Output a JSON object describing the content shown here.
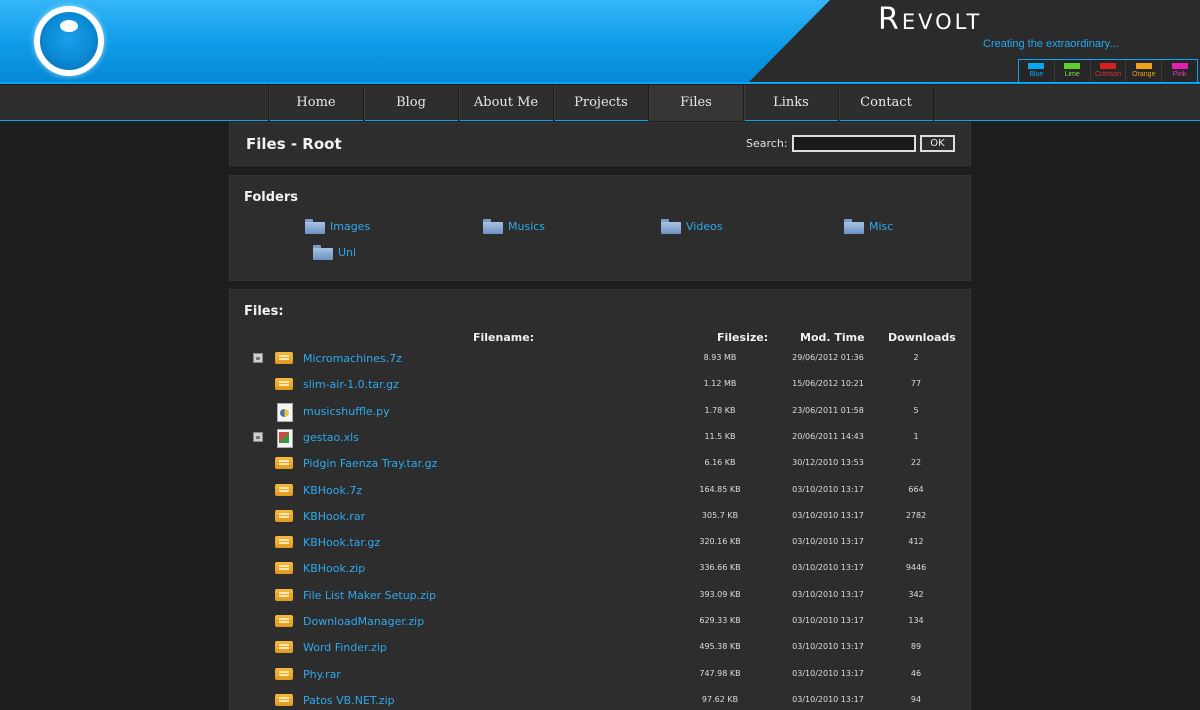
{
  "brand": {
    "title": "Revolt",
    "tagline": "Creating the extraordinary..."
  },
  "themes": [
    {
      "label": "Blue",
      "color": "#0aa5f5",
      "text": "#0aa5f5"
    },
    {
      "label": "Lime",
      "color": "#5ad12a",
      "text": "#7ce04a"
    },
    {
      "label": "Crimson",
      "color": "#d42020",
      "text": "#e03030"
    },
    {
      "label": "Orange",
      "color": "#f0a020",
      "text": "#f0a020"
    },
    {
      "label": "Pink",
      "color": "#e020b0",
      "text": "#e040c0"
    }
  ],
  "nav": [
    "Home",
    "Blog",
    "About Me",
    "Projects",
    "Files",
    "Links",
    "Contact"
  ],
  "nav_active": "Files",
  "page_title": "Files - Root",
  "search": {
    "label": "Search:",
    "value": "",
    "button": "OK"
  },
  "folders_title": "Folders",
  "folders": [
    "Images",
    "Musics",
    "Videos",
    "Misc",
    "Uni"
  ],
  "files_title": "Files:",
  "columns": {
    "filename": "Filename:",
    "filesize": "Filesize:",
    "modtime": "Mod. Time",
    "downloads": "Downloads"
  },
  "files": [
    {
      "name": "Micromachines.7z",
      "size": "8.93 MB",
      "time": "29/06/2012 01:36",
      "downloads": "2",
      "icon": "archive",
      "locked": true
    },
    {
      "name": "slim-air-1.0.tar.gz",
      "size": "1.12 MB",
      "time": "15/06/2012 10:21",
      "downloads": "77",
      "icon": "archive",
      "locked": false
    },
    {
      "name": "musicshuffle.py",
      "size": "1.78 KB",
      "time": "23/06/2011 01:58",
      "downloads": "5",
      "icon": "py",
      "locked": false
    },
    {
      "name": "gestao.xls",
      "size": "11.5 KB",
      "time": "20/06/2011 14:43",
      "downloads": "1",
      "icon": "xls",
      "locked": true
    },
    {
      "name": "Pidgin Faenza Tray.tar.gz",
      "size": "6.16 KB",
      "time": "30/12/2010 13:53",
      "downloads": "22",
      "icon": "archive",
      "locked": false
    },
    {
      "name": "KBHook.7z",
      "size": "164.85 KB",
      "time": "03/10/2010 13:17",
      "downloads": "664",
      "icon": "archive",
      "locked": false
    },
    {
      "name": "KBHook.rar",
      "size": "305.7 KB",
      "time": "03/10/2010 13:17",
      "downloads": "2782",
      "icon": "archive",
      "locked": false
    },
    {
      "name": "KBHook.tar.gz",
      "size": "320.16 KB",
      "time": "03/10/2010 13:17",
      "downloads": "412",
      "icon": "archive",
      "locked": false
    },
    {
      "name": "KBHook.zip",
      "size": "336.66 KB",
      "time": "03/10/2010 13:17",
      "downloads": "9446",
      "icon": "archive",
      "locked": false
    },
    {
      "name": "File List Maker Setup.zip",
      "size": "393.09 KB",
      "time": "03/10/2010 13:17",
      "downloads": "342",
      "icon": "archive",
      "locked": false
    },
    {
      "name": "DownloadManager.zip",
      "size": "629.33 KB",
      "time": "03/10/2010 13:17",
      "downloads": "134",
      "icon": "archive",
      "locked": false
    },
    {
      "name": "Word Finder.zip",
      "size": "495.38 KB",
      "time": "03/10/2010 13:17",
      "downloads": "89",
      "icon": "archive",
      "locked": false
    },
    {
      "name": "Phy.rar",
      "size": "747.98 KB",
      "time": "03/10/2010 13:17",
      "downloads": "46",
      "icon": "archive",
      "locked": false
    },
    {
      "name": "Patos VB.NET.zip",
      "size": "97.62 KB",
      "time": "03/10/2010 13:17",
      "downloads": "94",
      "icon": "archive",
      "locked": false
    }
  ]
}
